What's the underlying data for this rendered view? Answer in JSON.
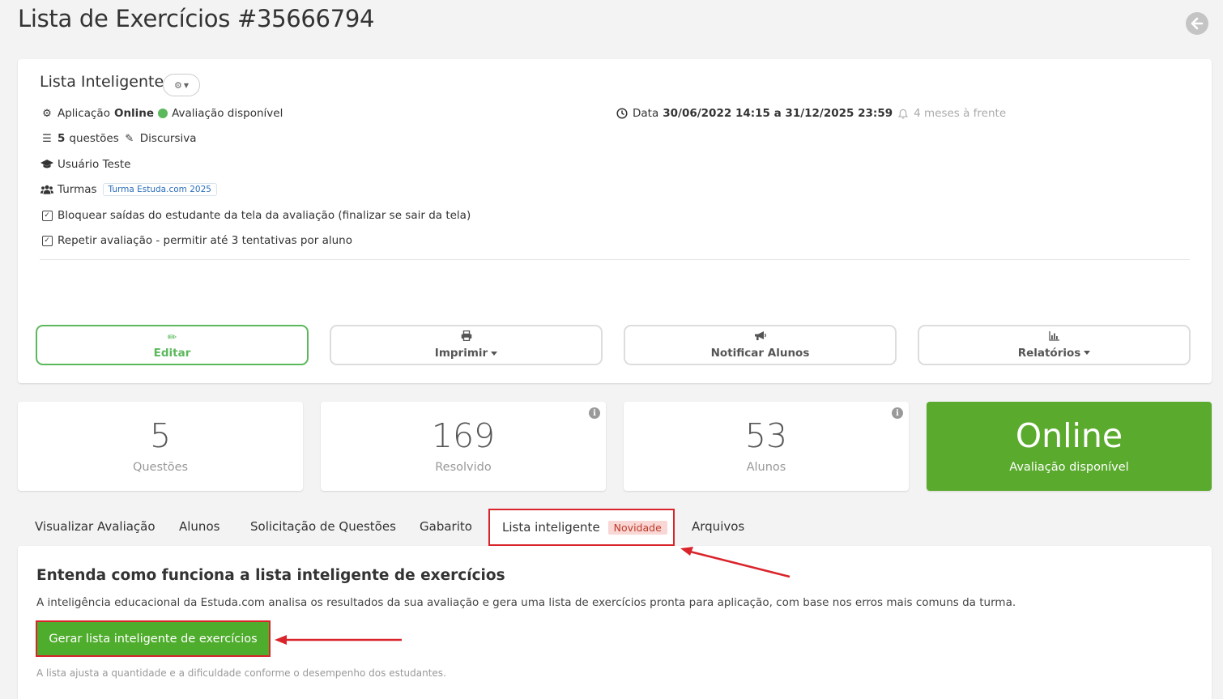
{
  "page": {
    "title": "Lista de Exercícios #35666794"
  },
  "header": {
    "back_icon": "arrow-left-circle-icon"
  },
  "info": {
    "list_name": "Lista Inteligente",
    "application_label": "Aplicação",
    "application_mode": "Online",
    "availability": "Avaliação disponível",
    "questions_count": "5",
    "questions_label": "questões",
    "question_type": "Discursiva",
    "author": "Usuário Teste",
    "classes_label": "Turmas",
    "class_tag": "Turma Estuda.com 2025",
    "option_block_exit": "Bloquear saídas do estudante da tela da avaliação (finalizar se sair da tela)",
    "option_repeat": "Repetir avaliação - permitir até 3 tentativas por aluno",
    "date_label": "Data",
    "date_range": "30/06/2022 14:15 a 31/12/2025 23:59",
    "relative_time": "4 meses à frente"
  },
  "actions": {
    "edit": "Editar",
    "print": "Imprimir",
    "notify": "Notificar Alunos",
    "reports": "Relatórios"
  },
  "stats": [
    {
      "value": "5",
      "label": "Questões"
    },
    {
      "value": "169",
      "label": "Resolvido"
    },
    {
      "value": "53",
      "label": "Alunos"
    },
    {
      "value": "Online",
      "label": "Avaliação disponível"
    }
  ],
  "tabs": {
    "view": "Visualizar Avaliação",
    "students": "Alunos",
    "requests": "Solicitação de Questões",
    "answer_key": "Gabarito",
    "smart_list": "Lista inteligente",
    "smart_list_badge": "Novidade",
    "files": "Arquivos"
  },
  "panel": {
    "title": "Entenda como funciona a lista inteligente de exercícios",
    "description": "A inteligência educacional da Estuda.com analisa os resultados da sua avaliação e gera uma lista de exercícios pronta para aplicação, com base nos erros mais comuns da turma.",
    "button": "Gerar lista inteligente de exercícios",
    "hint": "A lista ajusta a quantidade e a dificuldade conforme o desempenho dos estudantes."
  },
  "colors": {
    "accent_green": "#5aaa2d",
    "annotation_red": "#d9242b",
    "badge_bg": "#f8d7d4"
  }
}
